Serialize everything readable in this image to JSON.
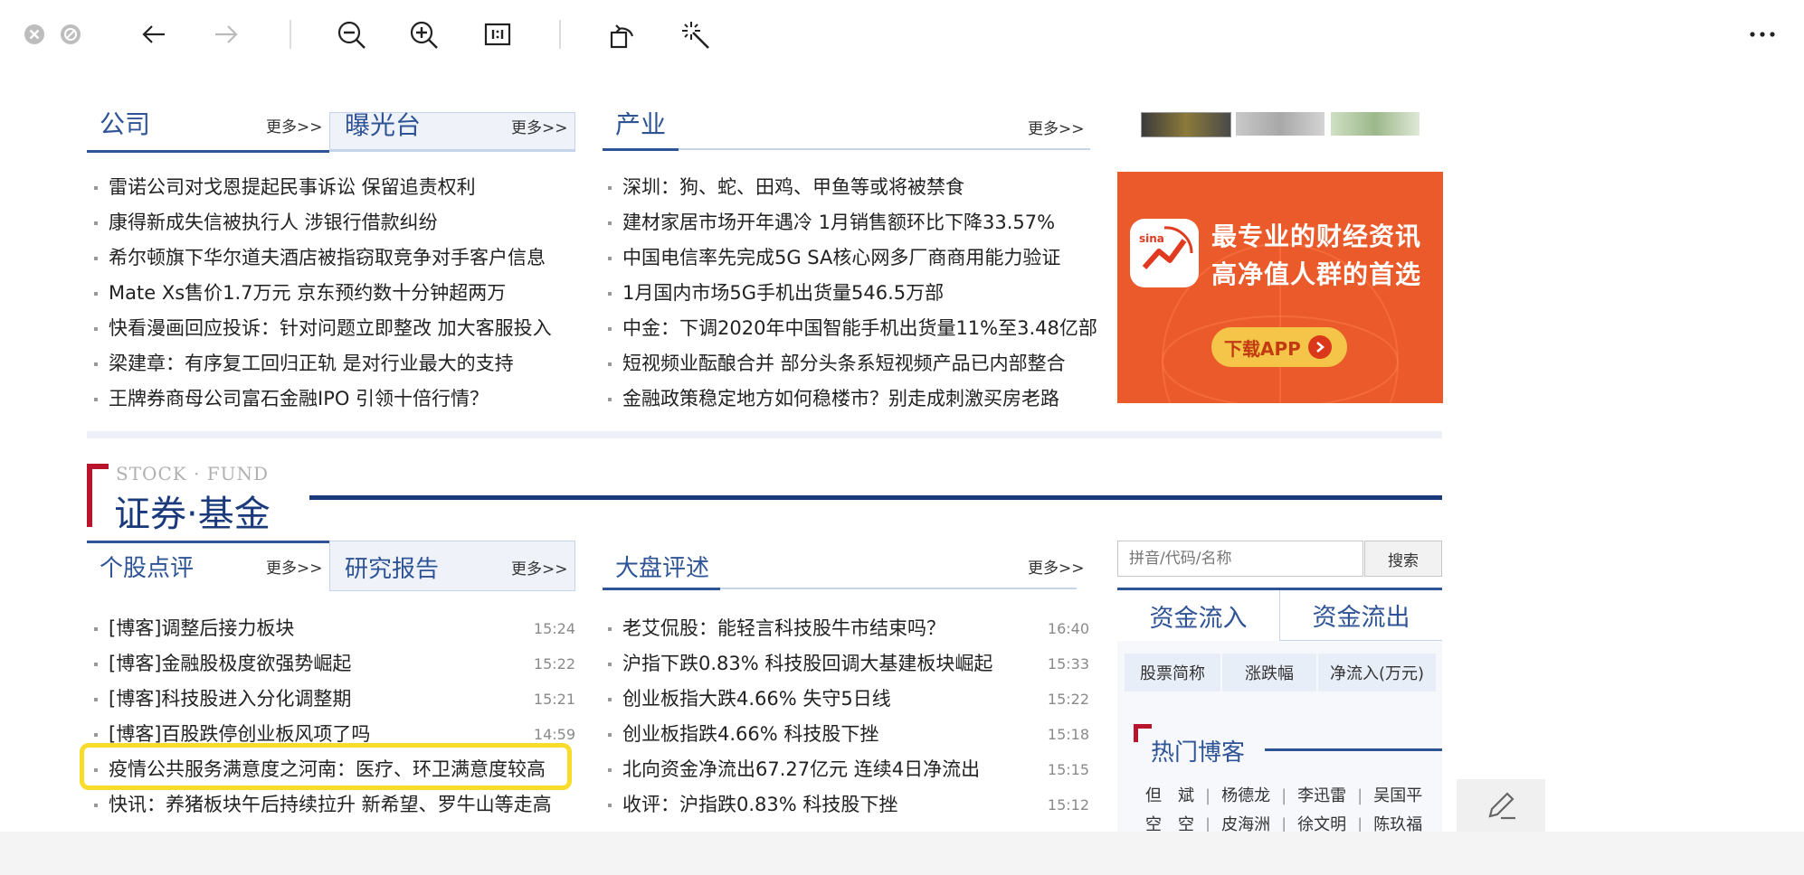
{
  "viewer": {
    "more_icon": "more-horizontal-icon"
  },
  "company": {
    "title": "公司",
    "more": "更多>>",
    "tab2": "曝光台",
    "tab2_more": "更多>>",
    "items": [
      "雷诺公司对戈恩提起民事诉讼 保留追责权利",
      "康得新成失信被执行人 涉银行借款纠纷",
      "希尔顿旗下华尔道夫酒店被指窃取竞争对手客户信息",
      "Mate Xs售价1.7万元 京东预约数十分钟超两万",
      "快看漫画回应投诉：针对问题立即整改 加大客服投入",
      "梁建章：有序复工回归正轨 是对行业最大的支持",
      "王牌券商母公司富石金融IPO 引领十倍行情？"
    ]
  },
  "industry": {
    "title": "产业",
    "more": "更多>>",
    "items": [
      "深圳：狗、蛇、田鸡、甲鱼等或将被禁食",
      "建材家居市场开年遇冷 1月销售额环比下降33.57%",
      "中国电信率先完成5G SA核心网多厂商商用能力验证",
      "1月国内市场5G手机出货量546.5万部",
      "中金：下调2020年中国智能手机出货量11%至3.48亿部",
      "短视频业酝酿合并 部分头条系短视频产品已内部整合",
      "金融政策稳定地方如何稳楼市？别走成刺激买房老路"
    ]
  },
  "ad": {
    "line1": "最专业的财经资讯",
    "line2": "高净值人群的首选",
    "button": "下载APP",
    "logo_text": "sina"
  },
  "securities": {
    "subtitle": "STOCK · FUND",
    "title": "证券·基金"
  },
  "stock_review": {
    "title": "个股点评",
    "more": "更多>>",
    "tab2": "研究报告",
    "tab2_more": "更多>>",
    "items": [
      {
        "text": "[博客]调整后接力板块",
        "time": "15:24"
      },
      {
        "text": "[博客]金融股极度欲强势崛起",
        "time": "15:22"
      },
      {
        "text": "[博客]科技股进入分化调整期",
        "time": "15:21"
      },
      {
        "text": "[博客]百股跌停创业板风项了吗",
        "time": "14:59"
      },
      {
        "text": "疫情公共服务满意度之河南：医疗、环卫满意度较高",
        "time": ""
      },
      {
        "text": "快讯：养猪板块午后持续拉升 新希望、罗牛山等走高",
        "time": ""
      }
    ]
  },
  "market_review": {
    "title": "大盘评述",
    "more": "更多>>",
    "items": [
      {
        "text": "老艾侃股：能轻言科技股牛市结束吗？",
        "time": "16:40"
      },
      {
        "text": "沪指下跌0.83% 科技股回调大基建板块崛起",
        "time": "15:33"
      },
      {
        "text": "创业板指大跌4.66% 失守5日线",
        "time": "15:22"
      },
      {
        "text": "创业板指跌4.66% 科技股下挫",
        "time": "15:18"
      },
      {
        "text": "北向资金净流出67.27亿元 连续4日净流出",
        "time": "15:15"
      },
      {
        "text": "收评：沪指跌0.83% 科技股下挫",
        "time": "15:12"
      }
    ]
  },
  "search": {
    "placeholder": "拼音/代码/名称",
    "button": "搜索"
  },
  "fund_flow": {
    "tab_in": "资金流入",
    "tab_out": "资金流出",
    "col1": "股票简称",
    "col2": "涨跌幅",
    "col3": "净流入(万元)"
  },
  "hot_blog": {
    "title": "热门博客",
    "row1": [
      "但　斌",
      "杨德龙",
      "李迅雷",
      "吴国平"
    ],
    "row2": [
      "空　空",
      "皮海洲",
      "徐文明",
      "陈玖福"
    ]
  },
  "colors": {
    "accent_blue": "#2f5496",
    "navy_bar": "#1a3a7c",
    "red_mark": "#b8142b",
    "highlight": "#f7dc2b",
    "ad_orange": "#ea5a2a"
  }
}
